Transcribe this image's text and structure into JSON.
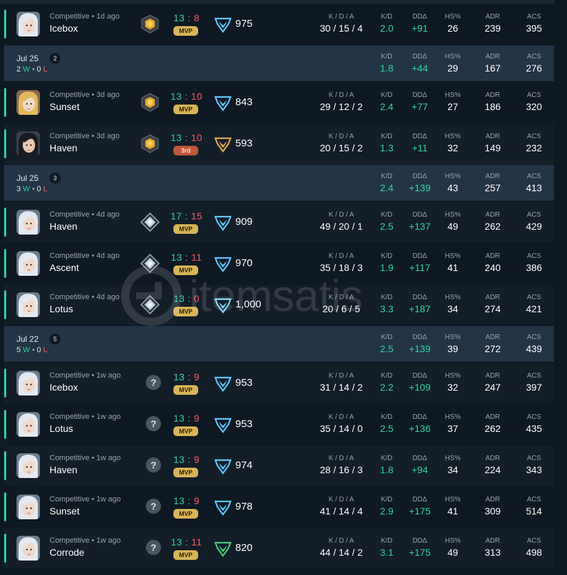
{
  "labels": {
    "kda": "K / D / A",
    "kd": "K/D",
    "dd": "DDΔ",
    "hs": "HS%",
    "adr": "ADR",
    "acs": "ACS"
  },
  "watermark": "itemsatis",
  "rows": [
    {
      "kind": "match",
      "avatar": "white",
      "sub": "Competitive • 1d ago",
      "map": "Icebox",
      "rank": "gold",
      "w": "13",
      "l": "8",
      "badge": "MVP",
      "rr": "975",
      "rr_color": "#5ec8ff",
      "kda": "30 / 15 / 4",
      "kd": "2.0",
      "dd": "+91",
      "hs": "26",
      "adr": "239",
      "acs": "395"
    },
    {
      "kind": "header",
      "date": "Jul 25",
      "count": "2",
      "wins": "2",
      "losses": "0",
      "kd": "1.8",
      "dd": "+44",
      "hs": "29",
      "adr": "167",
      "acs": "276"
    },
    {
      "kind": "match",
      "avatar": "blonde",
      "sub": "Competitive • 3d ago",
      "map": "Sunset",
      "rank": "gold",
      "w": "13",
      "l": "10",
      "badge": "MVP",
      "rr": "843",
      "rr_color": "#5ec8ff",
      "kda": "29 / 12 / 2",
      "kd": "2.4",
      "dd": "+77",
      "hs": "27",
      "adr": "186",
      "acs": "320"
    },
    {
      "kind": "match",
      "avatar": "dark",
      "sub": "Competitive • 3d ago",
      "map": "Haven",
      "rank": "gold",
      "w": "13",
      "l": "10",
      "badge": "3rd",
      "rr": "593",
      "rr_color": "#e0a94a",
      "kda": "20 / 15 / 2",
      "kd": "1.3",
      "dd": "+11",
      "hs": "32",
      "adr": "149",
      "acs": "232"
    },
    {
      "kind": "header",
      "date": "Jul 25",
      "count": "3",
      "wins": "3",
      "losses": "0",
      "kd": "2.4",
      "dd": "+139",
      "hs": "43",
      "adr": "257",
      "acs": "413"
    },
    {
      "kind": "match",
      "avatar": "white",
      "sub": "Competitive • 4d ago",
      "map": "Haven",
      "rank": "plat",
      "w": "17",
      "l": "15",
      "badge": "MVP",
      "rr": "909",
      "rr_color": "#5ec8ff",
      "kda": "49 / 20 / 1",
      "kd": "2.5",
      "dd": "+137",
      "hs": "49",
      "adr": "262",
      "acs": "429"
    },
    {
      "kind": "match",
      "avatar": "white",
      "sub": "Competitive • 4d ago",
      "map": "Ascent",
      "rank": "plat",
      "w": "13",
      "l": "11",
      "badge": "MVP",
      "rr": "970",
      "rr_color": "#5ec8ff",
      "kda": "35 / 18 / 3",
      "kd": "1.9",
      "dd": "+117",
      "hs": "41",
      "adr": "240",
      "acs": "386"
    },
    {
      "kind": "match",
      "avatar": "white",
      "sub": "Competitive • 4d ago",
      "map": "Lotus",
      "rank": "plat",
      "w": "13",
      "l": "0",
      "badge": "MVP",
      "rr": "1,000",
      "rr_color": "#7fd8ff",
      "kda": "20 / 6 / 5",
      "kd": "3.3",
      "dd": "+187",
      "hs": "34",
      "adr": "274",
      "acs": "421"
    },
    {
      "kind": "header",
      "date": "Jul 22",
      "count": "5",
      "wins": "5",
      "losses": "0",
      "kd": "2.5",
      "dd": "+139",
      "hs": "39",
      "adr": "272",
      "acs": "439"
    },
    {
      "kind": "match",
      "avatar": "white",
      "sub": "Competitive • 1w ago",
      "map": "Icebox",
      "rank": "unknown",
      "w": "13",
      "l": "9",
      "badge": "MVP",
      "rr": "953",
      "rr_color": "#5ec8ff",
      "kda": "31 / 14 / 2",
      "kd": "2.2",
      "dd": "+109",
      "hs": "32",
      "adr": "247",
      "acs": "397"
    },
    {
      "kind": "match",
      "avatar": "white",
      "sub": "Competitive • 1w ago",
      "map": "Lotus",
      "rank": "unknown",
      "w": "13",
      "l": "9",
      "badge": "MVP",
      "rr": "953",
      "rr_color": "#5ec8ff",
      "kda": "35 / 14 / 0",
      "kd": "2.5",
      "dd": "+136",
      "hs": "37",
      "adr": "262",
      "acs": "435"
    },
    {
      "kind": "match",
      "avatar": "white",
      "sub": "Competitive • 1w ago",
      "map": "Haven",
      "rank": "unknown",
      "w": "13",
      "l": "9",
      "badge": "MVP",
      "rr": "974",
      "rr_color": "#5ec8ff",
      "kda": "28 / 16 / 3",
      "kd": "1.8",
      "dd": "+94",
      "hs": "34",
      "adr": "224",
      "acs": "343"
    },
    {
      "kind": "match",
      "avatar": "white",
      "sub": "Competitive • 1w ago",
      "map": "Sunset",
      "rank": "unknown",
      "w": "13",
      "l": "9",
      "badge": "MVP",
      "rr": "978",
      "rr_color": "#5ec8ff",
      "kda": "41 / 14 / 4",
      "kd": "2.9",
      "dd": "+175",
      "hs": "41",
      "adr": "309",
      "acs": "514"
    },
    {
      "kind": "match",
      "avatar": "white",
      "sub": "Competitive • 1w ago",
      "map": "Corrode",
      "rank": "unknown",
      "w": "13",
      "l": "11",
      "badge": "MVP",
      "rr": "820",
      "rr_color": "#3fd07a",
      "kda": "44 / 14 / 2",
      "kd": "3.1",
      "dd": "+175",
      "hs": "49",
      "adr": "313",
      "acs": "498"
    }
  ]
}
